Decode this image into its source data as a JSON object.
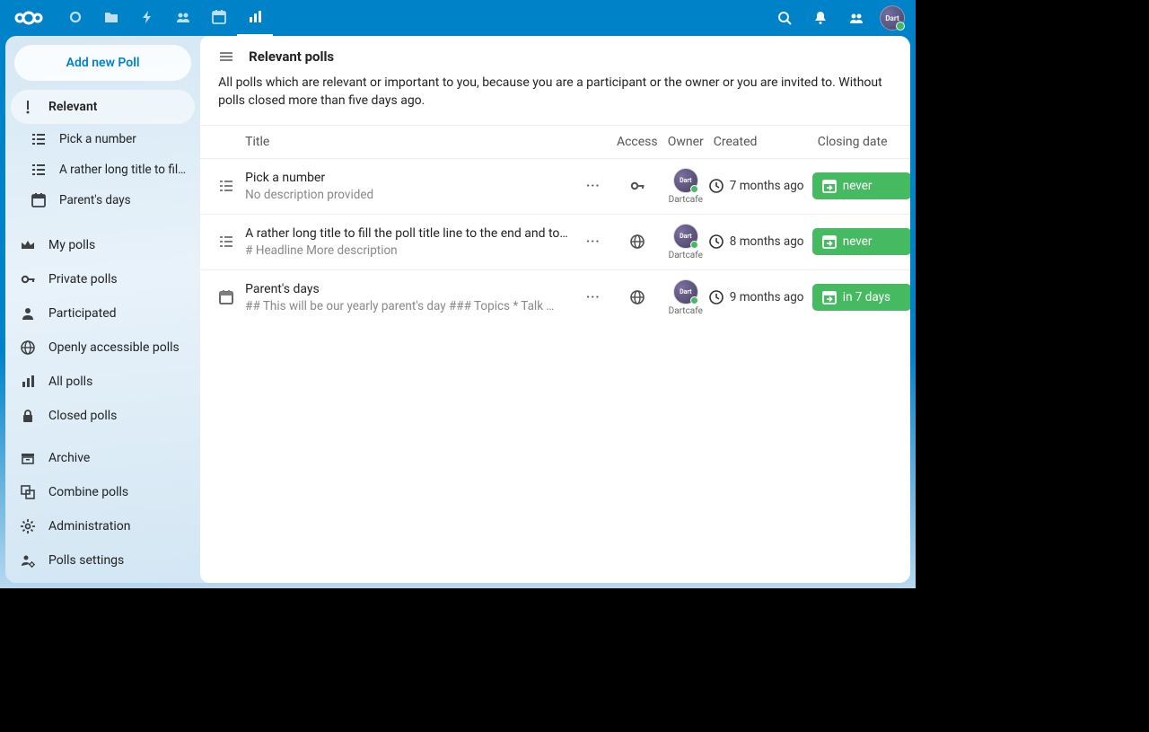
{
  "topbar": {
    "apps": [
      "dashboard",
      "files",
      "activity",
      "contacts",
      "calendar",
      "polls"
    ],
    "active": "polls"
  },
  "sidebar": {
    "new_button": "Add new Poll",
    "items": [
      {
        "icon": "priority",
        "label": "Relevant",
        "active": true
      },
      {
        "icon": "list",
        "label": "Pick a number",
        "sub": true
      },
      {
        "icon": "list",
        "label": "A rather long title to fil…",
        "sub": true
      },
      {
        "icon": "date",
        "label": "Parent's days",
        "sub": true
      },
      {
        "icon": "crown",
        "label": "My polls"
      },
      {
        "icon": "key",
        "label": "Private polls"
      },
      {
        "icon": "person",
        "label": "Participated"
      },
      {
        "icon": "globe",
        "label": "Openly accessible polls"
      },
      {
        "icon": "bars",
        "label": "All polls"
      },
      {
        "icon": "lock",
        "label": "Closed polls"
      }
    ],
    "bottom": [
      {
        "icon": "archive",
        "label": "Archive"
      },
      {
        "icon": "combine",
        "label": "Combine polls"
      },
      {
        "icon": "gear",
        "label": "Administration"
      },
      {
        "icon": "person-gear",
        "label": "Polls settings"
      }
    ]
  },
  "header": {
    "title": "Relevant polls",
    "description": "All polls which are relevant or important to you, because you are a participant or the owner or you are invited to. Without polls closed more than five days ago."
  },
  "columns": {
    "title": "Title",
    "access": "Access",
    "owner": "Owner",
    "created": "Created",
    "closing": "Closing date"
  },
  "rows": [
    {
      "type": "list",
      "title": "Pick a number",
      "desc": "No description provided",
      "access": "key",
      "owner": "Dartcafe",
      "created": "7 months ago",
      "closing": "never"
    },
    {
      "type": "list",
      "title": "A rather long title to fill the poll title line to the end and to…",
      "desc": "# Headline More description",
      "access": "globe",
      "owner": "Dartcafe",
      "created": "8 months ago",
      "closing": "never"
    },
    {
      "type": "date",
      "title": "Parent's days",
      "desc": "## This will be our yearly parent's day ### Topics * Talk …",
      "access": "globe",
      "owner": "Dartcafe",
      "created": "9 months ago",
      "closing": "in 7 days"
    }
  ]
}
